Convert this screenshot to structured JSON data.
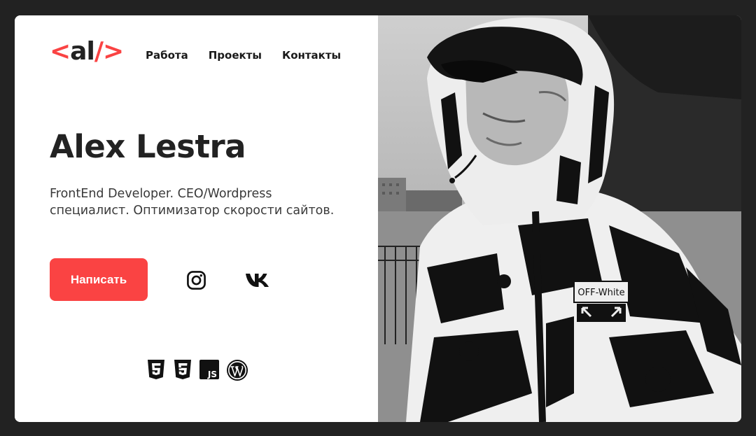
{
  "logo": {
    "open": "<",
    "text": "al",
    "close": "/>"
  },
  "nav": {
    "items": [
      {
        "label": "Работа"
      },
      {
        "label": "Проекты"
      },
      {
        "label": "Контакты"
      }
    ]
  },
  "hero": {
    "name": "Alex Lestra",
    "description": "FrontEnd Developer. CEO/Wordpress специалист. Оптимизатор скорости сайтов.",
    "cta_label": "Написать"
  },
  "social": [
    {
      "icon": "instagram-icon"
    },
    {
      "icon": "vk-icon"
    }
  ],
  "tech": [
    {
      "icon": "html5-icon"
    },
    {
      "icon": "css3-icon"
    },
    {
      "icon": "js-icon",
      "label": "JS"
    },
    {
      "icon": "wordpress-icon"
    }
  ],
  "photo": {
    "jacket_label": "OFF-White"
  },
  "colors": {
    "accent": "#fa4343",
    "page_background": "#222222",
    "card_background": "#ffffff",
    "text": "#222222"
  }
}
